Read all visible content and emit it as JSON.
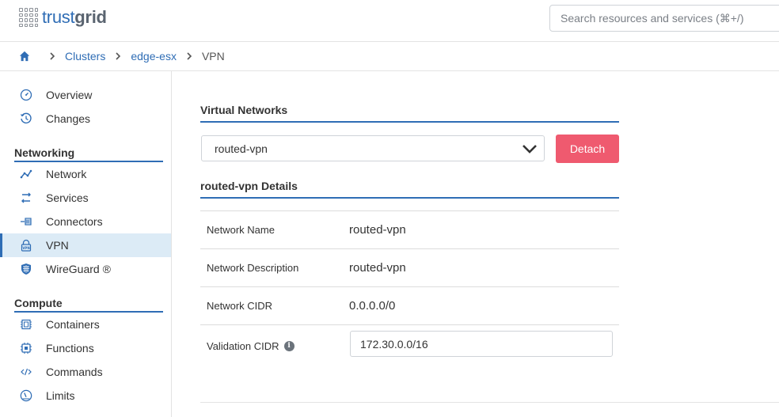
{
  "header": {
    "logo_part1": "trust",
    "logo_part2": "grid",
    "search_placeholder": "Search resources and services (⌘+/)"
  },
  "breadcrumb": {
    "items": [
      "Clusters",
      "edge-esx"
    ],
    "current": "VPN"
  },
  "sidebar": {
    "top_items": [
      {
        "label": "Overview",
        "icon": "gauge-icon"
      },
      {
        "label": "Changes",
        "icon": "history-icon"
      }
    ],
    "networking": {
      "title": "Networking",
      "items": [
        {
          "label": "Network",
          "icon": "network-icon"
        },
        {
          "label": "Services",
          "icon": "services-icon"
        },
        {
          "label": "Connectors",
          "icon": "connectors-icon"
        },
        {
          "label": "VPN",
          "icon": "vpn-lock-icon",
          "active": true
        },
        {
          "label": "WireGuard ®",
          "icon": "wireguard-shield-icon"
        }
      ]
    },
    "compute": {
      "title": "Compute",
      "items": [
        {
          "label": "Containers",
          "icon": "container-icon"
        },
        {
          "label": "Functions",
          "icon": "chip-icon"
        },
        {
          "label": "Commands",
          "icon": "code-icon"
        },
        {
          "label": "Limits",
          "icon": "speedometer-icon"
        }
      ]
    }
  },
  "main": {
    "virtual_networks_title": "Virtual Networks",
    "selected_network": "routed-vpn",
    "detach_label": "Detach",
    "details_title": "routed-vpn Details",
    "details": [
      {
        "label": "Network Name",
        "value": "routed-vpn"
      },
      {
        "label": "Network Description",
        "value": "routed-vpn"
      },
      {
        "label": "Network CIDR",
        "value": "0.0.0.0/0"
      }
    ],
    "validation_label": "Validation CIDR",
    "validation_value": "172.30.0.0/16"
  },
  "colors": {
    "accent": "#2f6db5",
    "danger": "#ef5a6f",
    "active_bg": "#dcebf6"
  }
}
